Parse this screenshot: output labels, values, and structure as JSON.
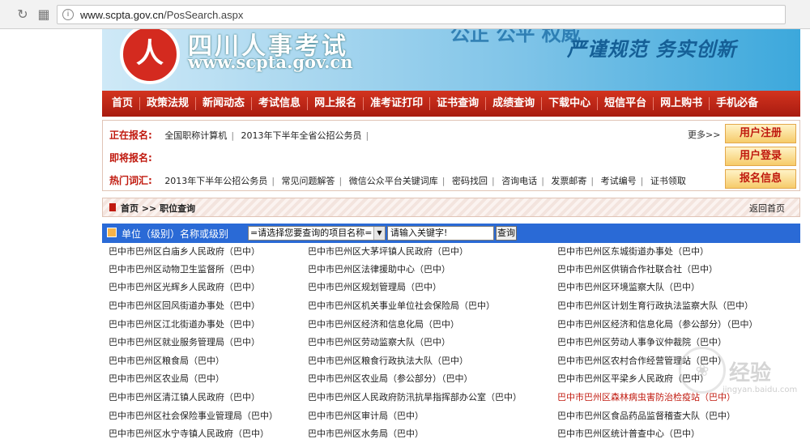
{
  "browser": {
    "url_host": "www.scpta.gov.cn",
    "url_path": "/PosSearch.aspx"
  },
  "banner": {
    "site_name": "四川人事考试",
    "site_domain": "www.scpta.gov.cn",
    "slogan_top": "公正 公平 权威",
    "slogan": "严谨规范 务实创新"
  },
  "menu": [
    "首页",
    "政策法规",
    "新闻动态",
    "考试信息",
    "网上报名",
    "准考证打印",
    "证书查询",
    "成绩查询",
    "下载中心",
    "短信平台",
    "网上购书",
    "手机必备"
  ],
  "info": {
    "registering_label": "正在报名:",
    "registering_items": [
      "全国职称计算机",
      "2013年下半年全省公招公务员"
    ],
    "upcoming_label": "即将报名:",
    "hot_label": "热门词汇:",
    "hot_items": [
      "2013年下半年公招公务员",
      "常见问题解答",
      "微信公众平台关键词库",
      "密码找回",
      "咨询电话",
      "发票邮寄",
      "考试编号",
      "证书领取"
    ],
    "more": "更多>>",
    "buttons": [
      "用户注册",
      "用户登录",
      "报名信息"
    ]
  },
  "breadcrumb": {
    "path": "首页 >> 职位查询",
    "back": "返回首页"
  },
  "search": {
    "label": "单位（级别）名称或级别",
    "select_value": "=请选择您要查询的项目名称=",
    "input_value": "请输入关键字!",
    "button": "查询"
  },
  "results": [
    [
      "巴中市巴州区白庙乡人民政府（巴中）",
      "巴中市巴州区大茅坪镇人民政府（巴中）",
      "巴中市巴州区东城街道办事处（巴中）"
    ],
    [
      "巴中市巴州区动物卫生监督所（巴中）",
      "巴中市巴州区法律援助中心（巴中）",
      "巴中市巴州区供销合作社联合社（巴中）"
    ],
    [
      "巴中市巴州区光辉乡人民政府（巴中）",
      "巴中市巴州区规划管理局（巴中）",
      "巴中市巴州区环境监察大队（巴中）"
    ],
    [
      "巴中市巴州区回风街道办事处（巴中）",
      "巴中市巴州区机关事业单位社会保险局（巴中）",
      "巴中市巴州区计划生育行政执法监察大队（巴中）"
    ],
    [
      "巴中市巴州区江北街道办事处（巴中）",
      "巴中市巴州区经济和信息化局（巴中）",
      "巴中市巴州区经济和信息化局（参公部分）（巴中）"
    ],
    [
      "巴中市巴州区就业服务管理局（巴中）",
      "巴中市巴州区劳动监察大队（巴中）",
      "巴中市巴州区劳动人事争议仲裁院（巴中）"
    ],
    [
      "巴中市巴州区粮食局（巴中）",
      "巴中市巴州区粮食行政执法大队（巴中）",
      "巴中市巴州区农村合作经营管理站（巴中）"
    ],
    [
      "巴中市巴州区农业局（巴中）",
      "巴中市巴州区农业局（参公部分）（巴中）",
      "巴中市巴州区平梁乡人民政府（巴中）"
    ],
    [
      "巴中市巴州区清江镇人民政府（巴中）",
      "巴中市巴州区人民政府防汛抗旱指挥部办公室（巴中）",
      "巴中市巴州区森林病虫害防治检疫站（巴中）"
    ],
    [
      "巴中市巴州区社会保险事业管理局（巴中）",
      "巴中市巴州区审计局（巴中）",
      "巴中市巴州区食品药品监督稽查大队（巴中）"
    ],
    [
      "巴中市巴州区水宁寺镇人民政府（巴中）",
      "巴中市巴州区水务局（巴中）",
      "巴中市巴州区统计普查中心（巴中）"
    ]
  ],
  "watermark": {
    "text": "经验",
    "sub": "jingyan.baidu.com"
  }
}
